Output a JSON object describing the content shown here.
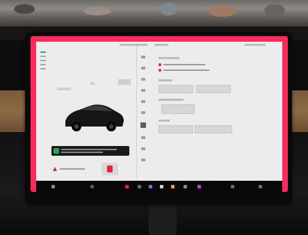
{
  "colors": {
    "accent": "#fb2a5a",
    "screen_background": "#ececec",
    "taskbar": "#080808",
    "alert": "#e0233b",
    "ok": "#29a35a"
  },
  "icons": {
    "alert": "warning-triangle-icon",
    "ok": "check-icon",
    "seat": "seat-icon",
    "car": "car-icon"
  }
}
